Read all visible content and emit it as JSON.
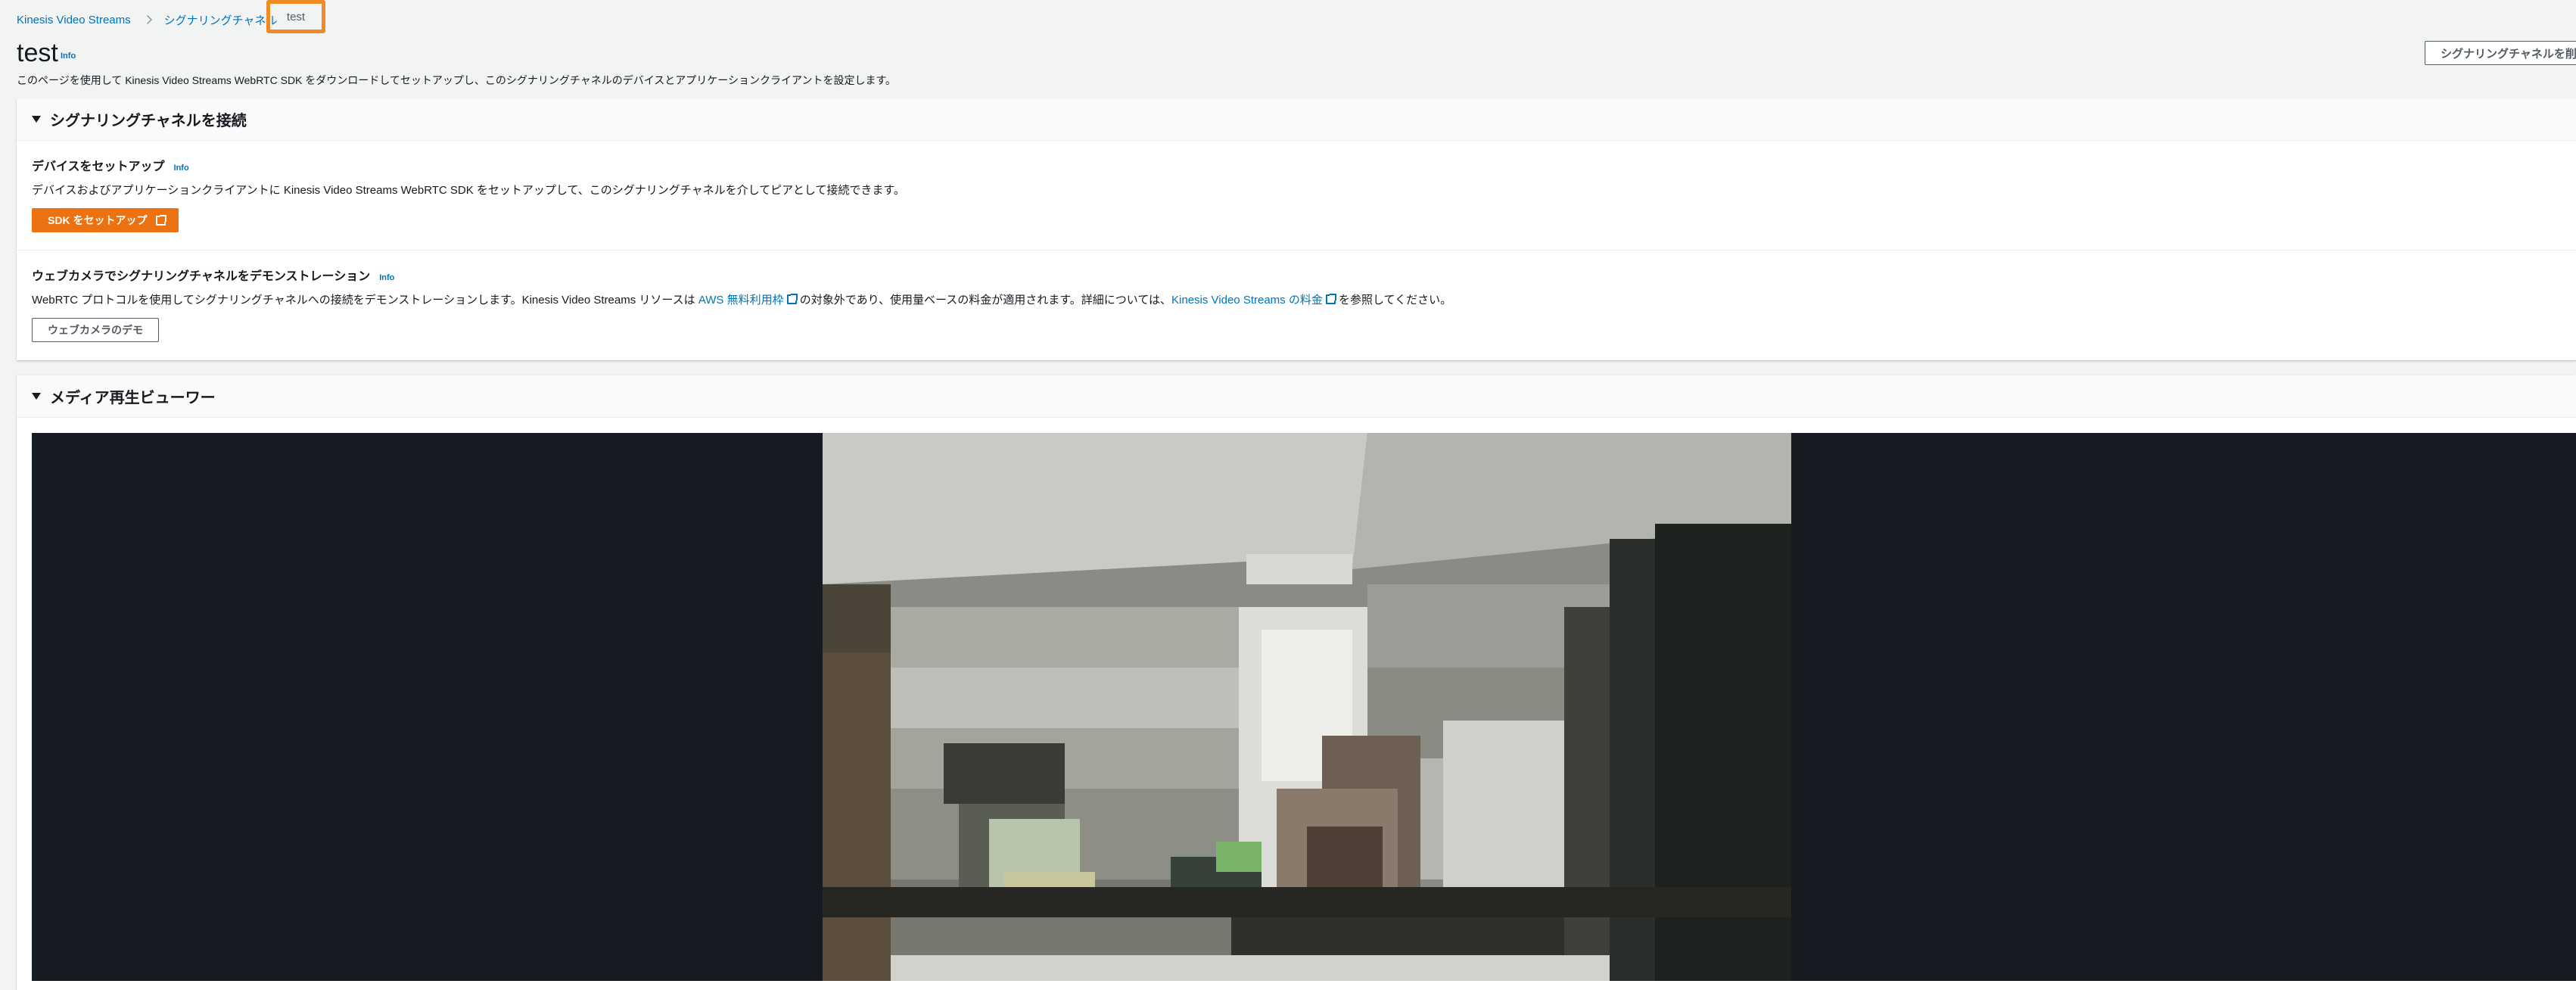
{
  "breadcrumb": {
    "items": [
      "Kinesis Video Streams",
      "シグナリングチャネル"
    ],
    "current": "test"
  },
  "header": {
    "title": "test",
    "info": "Info",
    "description": "このページを使用して Kinesis Video Streams WebRTC SDK をダウンロードしてセットアップし、このシグナリングチャネルのデバイスとアプリケーションクライアントを設定します。",
    "delete_button": "シグナリングチャネルを削除"
  },
  "connect_panel": {
    "title": "シグナリングチャネルを接続",
    "setup": {
      "title": "デバイスをセットアップ",
      "info": "Info",
      "description": "デバイスおよびアプリケーションクライアントに Kinesis Video Streams WebRTC SDK をセットアップして、このシグナリングチャネルを介してピアとして接続できます。",
      "button": "SDK をセットアップ"
    },
    "demo": {
      "title": "ウェブカメラでシグナリングチャネルをデモンストレーション",
      "info": "Info",
      "desc_part1": "WebRTC プロトコルを使用してシグナリングチャネルへの接続をデモンストレーションします。Kinesis Video Streams リソースは ",
      "link1": "AWS 無料利用枠",
      "desc_part2": " の対象外であり、使用量ベースの料金が適用されます。詳細については、",
      "link2": "Kinesis Video Streams の料金",
      "desc_part3": " を参照してください。",
      "button": "ウェブカメラのデモ"
    }
  },
  "media_panel": {
    "title": "メディア再生ビューワー"
  },
  "colors": {
    "accent_orange": "#ec7211",
    "link_blue": "#0073bb",
    "highlight_orange": "#f08a24",
    "video_background": "#161a22"
  }
}
